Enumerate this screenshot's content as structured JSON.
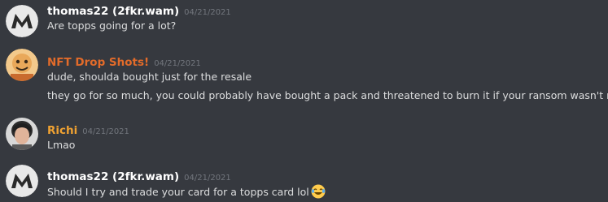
{
  "colors": {
    "background": "#36393f",
    "text": "#dcddde",
    "timestamp": "#72767d",
    "name_default": "#ffffff",
    "name_nft": "#e26b2a",
    "name_richi": "#f0a232"
  },
  "messages": [
    {
      "avatar_icon": "wax-m-logo-icon",
      "username": "thomas22 (2fkr.wam)",
      "timestamp": "04/21/2021",
      "lines": [
        "Are topps going for a lot?"
      ]
    },
    {
      "avatar_icon": "nft-drop-shots-avatar",
      "username": "NFT Drop Shots!",
      "timestamp": "04/21/2021",
      "lines": [
        "dude, shoulda bought just for the resale",
        "they go for so much, you could probably have bought a pack and threatened to burn it if your ransom wasn't met"
      ]
    },
    {
      "avatar_icon": "user-photo-avatar",
      "username": "Richi",
      "timestamp": "04/21/2021",
      "lines": [
        "Lmao"
      ]
    },
    {
      "avatar_icon": "wax-m-logo-icon",
      "username": "thomas22 (2fkr.wam)",
      "timestamp": "04/21/2021",
      "lines": [
        "Should I try and trade your card for a topps card lol"
      ],
      "trailing_emoji": "laughing-crying-emoji"
    }
  ]
}
